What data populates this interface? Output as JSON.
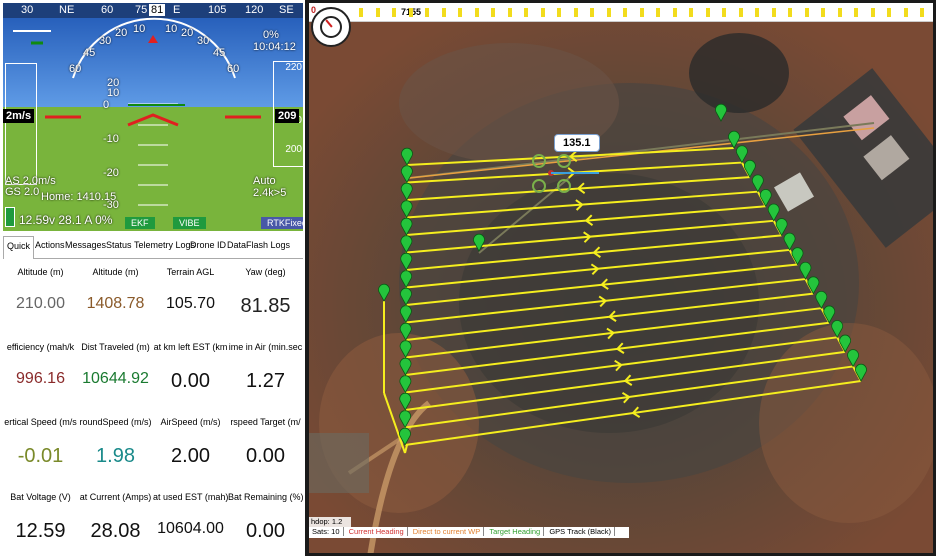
{
  "hud": {
    "compass_labels": [
      "30",
      "NE",
      "60",
      "75",
      "81",
      "E",
      "105",
      "120",
      "SE"
    ],
    "pitch_labels": [
      "20",
      "10",
      "0",
      "-10",
      "-20",
      "-30"
    ],
    "roll_labels_left": [
      "60",
      "45",
      "30",
      "20",
      "10"
    ],
    "roll_labels_right": [
      "10",
      "20",
      "30",
      "45",
      "60"
    ],
    "time_top": "0%",
    "clock": "10:04:12",
    "speed_box": "2m/s",
    "alt_box": "209",
    "alt_tape": [
      "220",
      "210",
      "200"
    ],
    "airspeed_line": "AS 2.0m/s",
    "groundspeed_line": "GS 2.0",
    "home_line": "Home: 1410.15",
    "mode": "Auto",
    "wp_dist": "2.4k>5",
    "battery_line": "12.59v 28.1 A 0%",
    "badges": [
      "EKF",
      "VIBE"
    ],
    "gps_badge": "RTKFixed"
  },
  "tabs": [
    "Quick",
    "Actions",
    "Messages",
    "Status",
    "Telemetry Logs",
    "Drone ID",
    "DataFlash Logs"
  ],
  "quick_items": [
    {
      "label": "Altitude (m)",
      "value": "210.00",
      "color": "#666666",
      "size": "normal"
    },
    {
      "label": "Altitude (m)",
      "value": "1408.78",
      "color": "#8a5a2a",
      "size": "normal"
    },
    {
      "label": "Terrain AGL",
      "value": "105.70",
      "color": "#111111",
      "size": "normal"
    },
    {
      "label": "Yaw (deg)",
      "value": "81.85",
      "color": "#222222",
      "size": "big"
    },
    {
      "label": "efficiency (mah/k",
      "value": "996.16",
      "color": "#8a2a2a",
      "size": "normal"
    },
    {
      "label": "Dist Traveled (m)",
      "value": "10644.92",
      "color": "#1a7a30",
      "size": "normal"
    },
    {
      "label": "at km left EST (km",
      "value": "0.00",
      "color": "#111111",
      "size": "big"
    },
    {
      "label": "ime in Air (min.sec",
      "value": "1.27",
      "color": "#111111",
      "size": "big"
    },
    {
      "label": "ertical Speed (m/s",
      "value": "-0.01",
      "color": "#7a8a2a",
      "size": "big"
    },
    {
      "label": "roundSpeed (m/s)",
      "value": "1.98",
      "color": "#1a8a8a",
      "size": "big"
    },
    {
      "label": "AirSpeed (m/s)",
      "value": "2.00",
      "color": "#111111",
      "size": "big"
    },
    {
      "label": "rspeed Target (m/",
      "value": "0.00",
      "color": "#111111",
      "size": "big"
    },
    {
      "label": "Bat Voltage (V)",
      "value": "12.59",
      "color": "#111111",
      "size": "big"
    },
    {
      "label": "at Current (Amps)",
      "value": "28.08",
      "color": "#111111",
      "size": "big"
    },
    {
      "label": "at used EST (mah)",
      "value": "10604.00",
      "color": "#111111",
      "size": "normal"
    },
    {
      "label": "Bat Remaining (%)",
      "value": "0.00",
      "color": "#111111",
      "size": "big"
    }
  ],
  "map": {
    "topbar_left": "0",
    "topbar_value": "7155",
    "waypoint_label": "135.1",
    "hdop": "hdop: 1.2",
    "sats": "Sats: 10",
    "legend": [
      {
        "text": "Current Heading",
        "color": "#d03030"
      },
      {
        "text": "Direct to current WP",
        "color": "#e08030"
      },
      {
        "text": "Target Heading",
        "color": "#30a030"
      },
      {
        "text": "GPS Track (Black)",
        "color": "#000000"
      }
    ],
    "track_color": "#f5ee1e",
    "waypoint_color": "#24c43c"
  }
}
